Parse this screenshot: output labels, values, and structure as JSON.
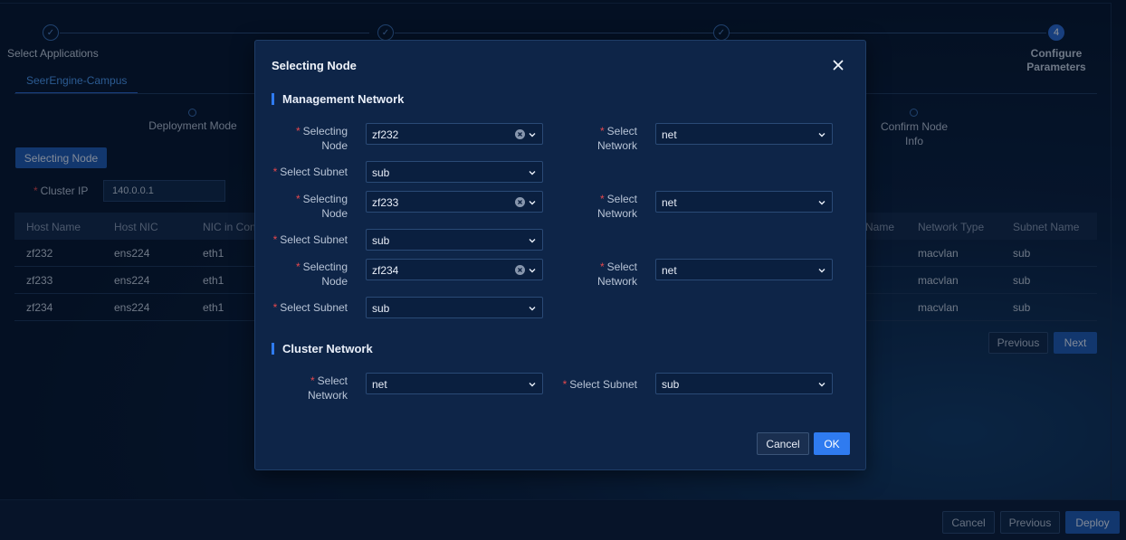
{
  "stepper": {
    "steps": [
      {
        "label": "Select Applications",
        "state": "done"
      },
      {
        "label": "",
        "state": "done"
      },
      {
        "label": "",
        "state": "done"
      },
      {
        "number": "4",
        "label_line1": "Configure",
        "label_line2": "Parameters",
        "state": "active"
      }
    ]
  },
  "tab": {
    "label": "SeerEngine-Campus"
  },
  "substeps": {
    "first": "Deployment Mode",
    "last_line1": "Confirm Node",
    "last_line2": "Info"
  },
  "background": {
    "selecting_node_button": "Selecting Node",
    "cluster_ip_label": "Cluster IP",
    "cluster_ip_value": "140.0.0.1",
    "table": {
      "headers_left": [
        "Host Name",
        "Host NIC",
        "NIC in Cont"
      ],
      "headers_right": [
        "Name",
        "Network Type",
        "Subnet Name"
      ],
      "rows": [
        {
          "host": "zf232",
          "nic": "ens224",
          "cont": "eth1",
          "type": "macvlan",
          "subnet": "sub"
        },
        {
          "host": "zf233",
          "nic": "ens224",
          "cont": "eth1",
          "type": "macvlan",
          "subnet": "sub"
        },
        {
          "host": "zf234",
          "nic": "ens224",
          "cont": "eth1",
          "type": "macvlan",
          "subnet": "sub"
        }
      ]
    },
    "previous_label": "Previous",
    "next_label": "Next"
  },
  "footer": {
    "cancel_label": "Cancel",
    "previous_label": "Previous",
    "deploy_label": "Deploy"
  },
  "modal": {
    "title": "Selecting Node",
    "management_title": "Management Network",
    "cluster_title": "Cluster Network",
    "labels": {
      "selecting_line1": "Selecting",
      "selecting_line2": "Node",
      "select_line1": "Select",
      "network_line2": "Network",
      "select_subnet": "Select Subnet"
    },
    "nodes": [
      {
        "node": "zf232",
        "network": "net",
        "subnet": "sub"
      },
      {
        "node": "zf233",
        "network": "net",
        "subnet": "sub"
      },
      {
        "node": "zf234",
        "network": "net",
        "subnet": "sub"
      }
    ],
    "cluster": {
      "network": "net",
      "subnet": "sub"
    },
    "cancel_label": "Cancel",
    "ok_label": "OK"
  },
  "colors": {
    "accent": "#2f7bf0",
    "required": "#e5484d",
    "modal_bg": "#0e2548",
    "page_bg": "#07152c"
  }
}
